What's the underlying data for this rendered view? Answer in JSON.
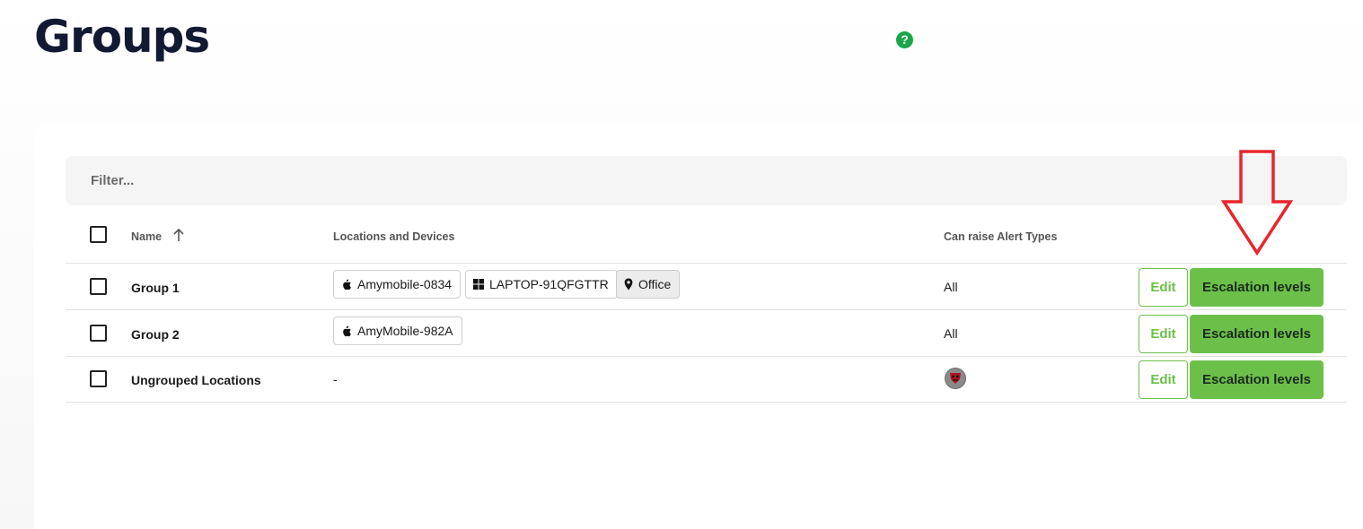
{
  "page": {
    "title": "Groups"
  },
  "filter": {
    "placeholder": "Filter..."
  },
  "table": {
    "columns": {
      "name": "Name",
      "locations": "Locations and Devices",
      "alerts": "Can raise Alert Types"
    },
    "rows": [
      {
        "name": "Group 1",
        "devices": [
          {
            "label": "Amymobile-0834",
            "icon": "apple-icon"
          },
          {
            "label": "LAPTOP-91QFGTTR",
            "icon": "windows-icon"
          },
          {
            "label": "Office",
            "icon": "location-pin-icon"
          }
        ],
        "alerts": "All",
        "edit_label": "Edit",
        "escalation_label": "Escalation levels"
      },
      {
        "name": "Group 2",
        "devices": [
          {
            "label": "AmyMobile-982A",
            "icon": "apple-icon"
          }
        ],
        "alerts": "All",
        "edit_label": "Edit",
        "escalation_label": "Escalation levels"
      },
      {
        "name": "Ungrouped Locations",
        "devices_text": "-",
        "alerts_icon": "alert-type-icon",
        "edit_label": "Edit",
        "escalation_label": "Escalation levels"
      }
    ]
  },
  "colors": {
    "accent_green": "#6cc04a",
    "help_green": "#1aa648",
    "title_navy": "#121a33",
    "annotation_red": "#e8262d"
  }
}
